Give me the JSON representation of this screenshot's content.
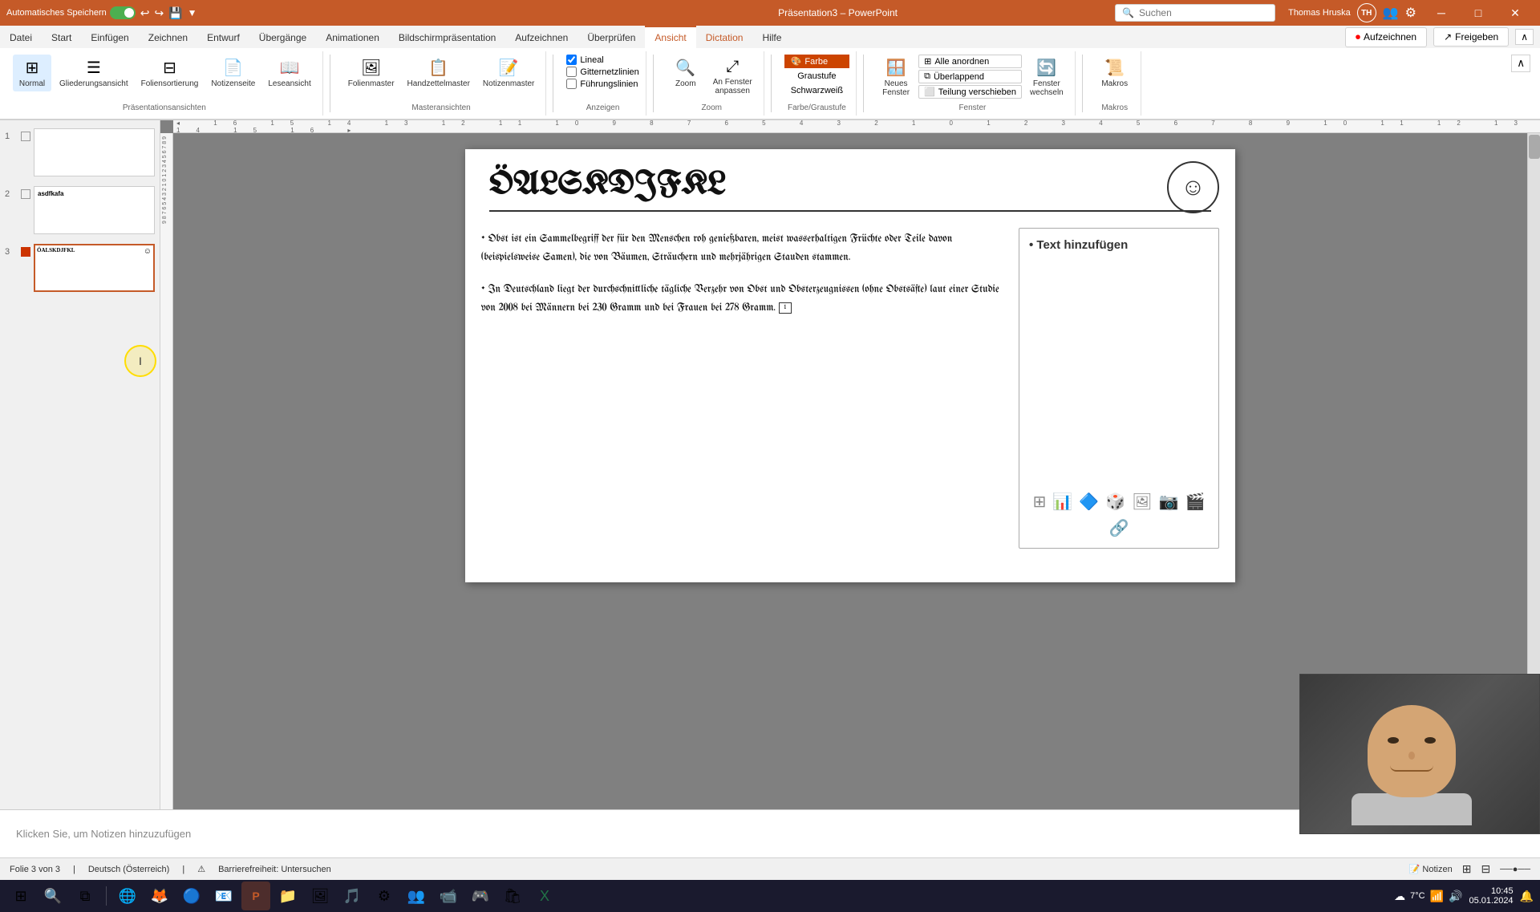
{
  "title_bar": {
    "autosave_label": "Automatisches Speichern",
    "app_name": "PowerPoint",
    "file_name": "Präsentation3",
    "user_name": "Thomas Hruska",
    "user_initials": "TH",
    "search_placeholder": "Suchen",
    "minimize": "─",
    "maximize": "□",
    "close": "✕"
  },
  "ribbon": {
    "tabs": [
      "Datei",
      "Start",
      "Einfügen",
      "Zeichnen",
      "Entwurf",
      "Übergänge",
      "Animationen",
      "Bildschirmpräsentation",
      "Aufzeichnen",
      "Überprüfen",
      "Ansicht",
      "Dictation",
      "Hilfe"
    ],
    "active_tab": "Ansicht",
    "dictation_tab": "Dictation",
    "groups": {
      "prasentationsansichten": {
        "label": "Präsentationsansichten",
        "buttons": [
          "Normal",
          "Gliederungsansicht",
          "Foliensortierung",
          "Notizenseite",
          "Leseansicht"
        ]
      },
      "masteransichten": {
        "label": "Masteransichten",
        "buttons": [
          "Folienmaster",
          "Handzettelmaster",
          "Notizenmaster"
        ]
      },
      "anzeigen": {
        "label": "Anzeigen",
        "checkboxes": [
          "Lineal",
          "Gitternetzlinien",
          "Führungslinien"
        ]
      },
      "zoom": {
        "label": "Zoom",
        "buttons": [
          "Zoom",
          "An Fenster anpassen"
        ]
      },
      "farbe": {
        "label": "Farbe/Graustufe",
        "buttons": [
          "Farbe",
          "Graustufe",
          "Schwarzweiß"
        ]
      },
      "fenster": {
        "label": "Fenster",
        "buttons": [
          "Alle anordnen",
          "Überlappend",
          "Teilung verschieben",
          "Neues Fenster",
          "Fenster wechseln"
        ]
      },
      "makros": {
        "label": "Makros",
        "buttons": [
          "Makros"
        ]
      }
    },
    "record_btn": "Aufzeichnen",
    "share_btn": "Freigeben"
  },
  "slides": [
    {
      "num": "1",
      "title": "",
      "has_icon": false,
      "color": ""
    },
    {
      "num": "2",
      "title": "asdfkafa",
      "has_icon": false,
      "color": ""
    },
    {
      "num": "3",
      "title": "öalskdjfkl",
      "has_icon": true,
      "color": "red",
      "active": true
    }
  ],
  "slide_content": {
    "title": "ÖALSKDJFKL",
    "bullets": [
      "Obst ist ein Sammelbegriff der für den Menschen roh genießbaren, meist wasserhaltigen Früchte oder Teile davon (beispielsweise Samen), die von Bäumen, Sträuchern und mehrjährigen Stauden stammen.",
      "In Deutschland liegt der durchschnittliche tägliche Verzehr von Obst und Obsterzeugnissen (ohne Obstsäfte) laut einer Studie von 2008 bei Männern bei 230 Gramm und bei Frauen bei 278 Gramm."
    ],
    "right_placeholder": "• Text hinzufügen"
  },
  "notes": {
    "placeholder": "Klicken Sie, um Notizen hinzuzufügen"
  },
  "status_bar": {
    "slide_info": "Folie 3 von 3",
    "language": "Deutsch (Österreich)",
    "accessibility": "Barrierefreiheit: Untersuchen",
    "notes_btn": "Notizen"
  },
  "taskbar": {
    "time": "7°C",
    "system_tray_icons": [
      "⌂",
      "🔍",
      "☁"
    ]
  },
  "cursor": {
    "symbol": "I"
  }
}
